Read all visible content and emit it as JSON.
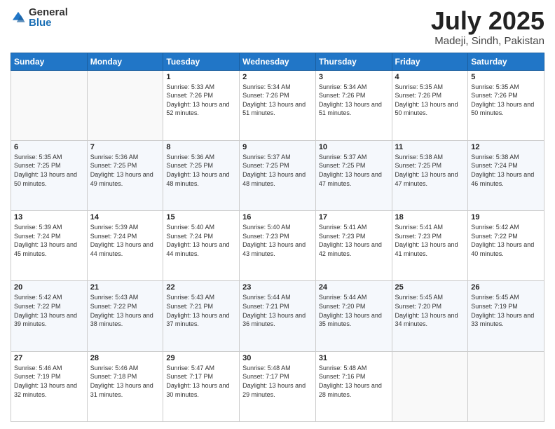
{
  "logo": {
    "general": "General",
    "blue": "Blue"
  },
  "title": {
    "month_year": "July 2025",
    "location": "Madeji, Sindh, Pakistan"
  },
  "weekdays": [
    "Sunday",
    "Monday",
    "Tuesday",
    "Wednesday",
    "Thursday",
    "Friday",
    "Saturday"
  ],
  "weeks": [
    [
      {
        "day": "",
        "sunrise": "",
        "sunset": "",
        "daylight": ""
      },
      {
        "day": "",
        "sunrise": "",
        "sunset": "",
        "daylight": ""
      },
      {
        "day": "1",
        "sunrise": "Sunrise: 5:33 AM",
        "sunset": "Sunset: 7:26 PM",
        "daylight": "Daylight: 13 hours and 52 minutes."
      },
      {
        "day": "2",
        "sunrise": "Sunrise: 5:34 AM",
        "sunset": "Sunset: 7:26 PM",
        "daylight": "Daylight: 13 hours and 51 minutes."
      },
      {
        "day": "3",
        "sunrise": "Sunrise: 5:34 AM",
        "sunset": "Sunset: 7:26 PM",
        "daylight": "Daylight: 13 hours and 51 minutes."
      },
      {
        "day": "4",
        "sunrise": "Sunrise: 5:35 AM",
        "sunset": "Sunset: 7:26 PM",
        "daylight": "Daylight: 13 hours and 50 minutes."
      },
      {
        "day": "5",
        "sunrise": "Sunrise: 5:35 AM",
        "sunset": "Sunset: 7:26 PM",
        "daylight": "Daylight: 13 hours and 50 minutes."
      }
    ],
    [
      {
        "day": "6",
        "sunrise": "Sunrise: 5:35 AM",
        "sunset": "Sunset: 7:25 PM",
        "daylight": "Daylight: 13 hours and 50 minutes."
      },
      {
        "day": "7",
        "sunrise": "Sunrise: 5:36 AM",
        "sunset": "Sunset: 7:25 PM",
        "daylight": "Daylight: 13 hours and 49 minutes."
      },
      {
        "day": "8",
        "sunrise": "Sunrise: 5:36 AM",
        "sunset": "Sunset: 7:25 PM",
        "daylight": "Daylight: 13 hours and 48 minutes."
      },
      {
        "day": "9",
        "sunrise": "Sunrise: 5:37 AM",
        "sunset": "Sunset: 7:25 PM",
        "daylight": "Daylight: 13 hours and 48 minutes."
      },
      {
        "day": "10",
        "sunrise": "Sunrise: 5:37 AM",
        "sunset": "Sunset: 7:25 PM",
        "daylight": "Daylight: 13 hours and 47 minutes."
      },
      {
        "day": "11",
        "sunrise": "Sunrise: 5:38 AM",
        "sunset": "Sunset: 7:25 PM",
        "daylight": "Daylight: 13 hours and 47 minutes."
      },
      {
        "day": "12",
        "sunrise": "Sunrise: 5:38 AM",
        "sunset": "Sunset: 7:24 PM",
        "daylight": "Daylight: 13 hours and 46 minutes."
      }
    ],
    [
      {
        "day": "13",
        "sunrise": "Sunrise: 5:39 AM",
        "sunset": "Sunset: 7:24 PM",
        "daylight": "Daylight: 13 hours and 45 minutes."
      },
      {
        "day": "14",
        "sunrise": "Sunrise: 5:39 AM",
        "sunset": "Sunset: 7:24 PM",
        "daylight": "Daylight: 13 hours and 44 minutes."
      },
      {
        "day": "15",
        "sunrise": "Sunrise: 5:40 AM",
        "sunset": "Sunset: 7:24 PM",
        "daylight": "Daylight: 13 hours and 44 minutes."
      },
      {
        "day": "16",
        "sunrise": "Sunrise: 5:40 AM",
        "sunset": "Sunset: 7:23 PM",
        "daylight": "Daylight: 13 hours and 43 minutes."
      },
      {
        "day": "17",
        "sunrise": "Sunrise: 5:41 AM",
        "sunset": "Sunset: 7:23 PM",
        "daylight": "Daylight: 13 hours and 42 minutes."
      },
      {
        "day": "18",
        "sunrise": "Sunrise: 5:41 AM",
        "sunset": "Sunset: 7:23 PM",
        "daylight": "Daylight: 13 hours and 41 minutes."
      },
      {
        "day": "19",
        "sunrise": "Sunrise: 5:42 AM",
        "sunset": "Sunset: 7:22 PM",
        "daylight": "Daylight: 13 hours and 40 minutes."
      }
    ],
    [
      {
        "day": "20",
        "sunrise": "Sunrise: 5:42 AM",
        "sunset": "Sunset: 7:22 PM",
        "daylight": "Daylight: 13 hours and 39 minutes."
      },
      {
        "day": "21",
        "sunrise": "Sunrise: 5:43 AM",
        "sunset": "Sunset: 7:22 PM",
        "daylight": "Daylight: 13 hours and 38 minutes."
      },
      {
        "day": "22",
        "sunrise": "Sunrise: 5:43 AM",
        "sunset": "Sunset: 7:21 PM",
        "daylight": "Daylight: 13 hours and 37 minutes."
      },
      {
        "day": "23",
        "sunrise": "Sunrise: 5:44 AM",
        "sunset": "Sunset: 7:21 PM",
        "daylight": "Daylight: 13 hours and 36 minutes."
      },
      {
        "day": "24",
        "sunrise": "Sunrise: 5:44 AM",
        "sunset": "Sunset: 7:20 PM",
        "daylight": "Daylight: 13 hours and 35 minutes."
      },
      {
        "day": "25",
        "sunrise": "Sunrise: 5:45 AM",
        "sunset": "Sunset: 7:20 PM",
        "daylight": "Daylight: 13 hours and 34 minutes."
      },
      {
        "day": "26",
        "sunrise": "Sunrise: 5:45 AM",
        "sunset": "Sunset: 7:19 PM",
        "daylight": "Daylight: 13 hours and 33 minutes."
      }
    ],
    [
      {
        "day": "27",
        "sunrise": "Sunrise: 5:46 AM",
        "sunset": "Sunset: 7:19 PM",
        "daylight": "Daylight: 13 hours and 32 minutes."
      },
      {
        "day": "28",
        "sunrise": "Sunrise: 5:46 AM",
        "sunset": "Sunset: 7:18 PM",
        "daylight": "Daylight: 13 hours and 31 minutes."
      },
      {
        "day": "29",
        "sunrise": "Sunrise: 5:47 AM",
        "sunset": "Sunset: 7:17 PM",
        "daylight": "Daylight: 13 hours and 30 minutes."
      },
      {
        "day": "30",
        "sunrise": "Sunrise: 5:48 AM",
        "sunset": "Sunset: 7:17 PM",
        "daylight": "Daylight: 13 hours and 29 minutes."
      },
      {
        "day": "31",
        "sunrise": "Sunrise: 5:48 AM",
        "sunset": "Sunset: 7:16 PM",
        "daylight": "Daylight: 13 hours and 28 minutes."
      },
      {
        "day": "",
        "sunrise": "",
        "sunset": "",
        "daylight": ""
      },
      {
        "day": "",
        "sunrise": "",
        "sunset": "",
        "daylight": ""
      }
    ]
  ]
}
